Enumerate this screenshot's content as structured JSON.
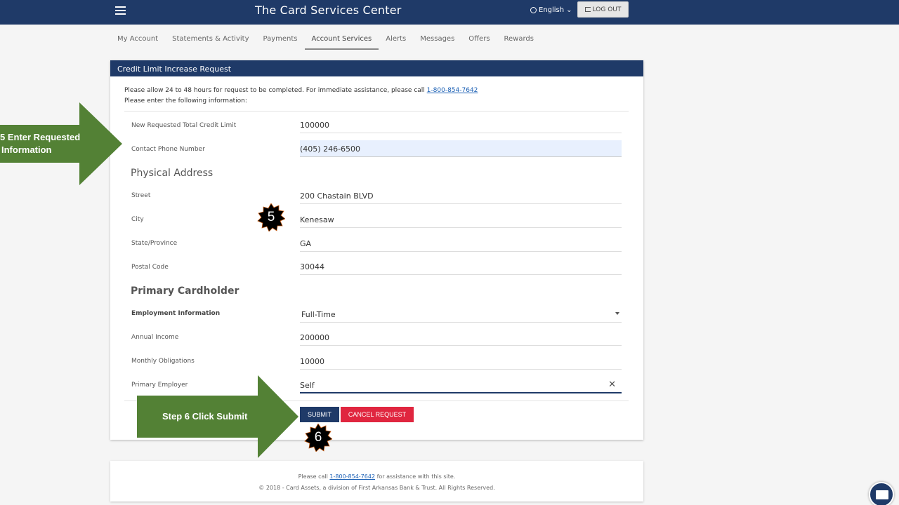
{
  "header": {
    "title": "The Card Services Center",
    "language": "English",
    "logout_label": "LOG OUT",
    "bg_color": "#1f3a68"
  },
  "nav": {
    "items": [
      {
        "label": "My Account"
      },
      {
        "label": "Statements & Activity"
      },
      {
        "label": "Payments"
      },
      {
        "label": "Account Services"
      },
      {
        "label": "Alerts"
      },
      {
        "label": "Messages"
      },
      {
        "label": "Offers"
      },
      {
        "label": "Rewards"
      }
    ],
    "active": "Account Services"
  },
  "form": {
    "title": "Credit Limit Increase Request",
    "info_line1": "Please allow 24 to 48 hours for request to be completed. For immediate assistance, please call",
    "phone_link": "1-800-854-7642",
    "info_line2": "Please enter the following information:",
    "credit_limit": {
      "label": "New Requested Total Credit Limit",
      "value": "100000"
    },
    "contact_phone": {
      "label": "Contact Phone Number",
      "value": "(405) 246-6500"
    },
    "address_section": "Physical Address",
    "street": {
      "label": "Street",
      "value": "200 Chastain BLVD"
    },
    "city": {
      "label": "City",
      "value": "Kenesaw"
    },
    "state": {
      "label": "State/Province",
      "value": "GA"
    },
    "postal": {
      "label": "Postal Code",
      "value": "30044"
    },
    "cardholder_section": "Primary Cardholder",
    "employment": {
      "label": "Employment Information",
      "value": "Full-Time"
    },
    "income": {
      "label": "Annual Income",
      "value": "200000"
    },
    "obligations": {
      "label": "Monthly Obligations",
      "value": "10000"
    },
    "employer": {
      "label": "Primary Employer",
      "value": "Self"
    },
    "submit_label": "SUBMIT",
    "cancel_label": "CANCEL REQUEST"
  },
  "footer": {
    "line1_prefix": "Please call",
    "phone_link": "1-800-854-7642",
    "line1_suffix": "for assistance with this site.",
    "line2": "© 2018 - Card Assets, a division of First Arkansas Bank & Trust. All Rights Reserved."
  },
  "annotations": {
    "step5_text_line1": "5 Enter Requested",
    "step5_text_line2": "Information",
    "step5_badge": "5",
    "step6_text": "Step 6 Click Submit",
    "step6_badge": "6",
    "arrow_color": "#538135"
  }
}
